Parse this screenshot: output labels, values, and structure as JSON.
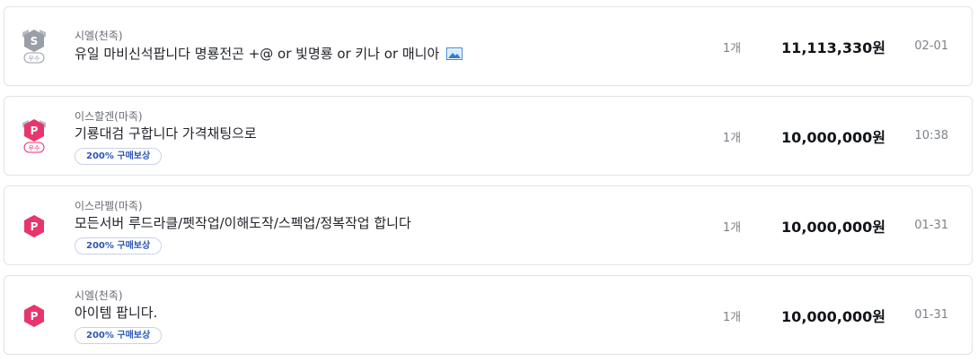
{
  "colors": {
    "power_seller_pink": "#e8356b",
    "silver_gray": "#9a9ea6",
    "reward_blue": "#2b56b8",
    "price_text": "#111418"
  },
  "listings": [
    {
      "badge_icon": "silver-seller-badge-icon",
      "badge_text": "우수",
      "server": "시엘(천족)",
      "title": "유일 마비신석팝니다 명룡전곤 +@ or 빛명룡 or 키나 or 매니아",
      "has_image": true,
      "reward": "",
      "qty": "1개",
      "price": "11,113,330원",
      "time": "02-01"
    },
    {
      "badge_icon": "power-seller-excellent-badge-icon",
      "badge_text": "우수",
      "server": "이스할겐(마족)",
      "title": "기룡대검 구합니다 가격채팅으로",
      "has_image": false,
      "reward": "200% 구매보상",
      "qty": "1개",
      "price": "10,000,000원",
      "time": "10:38"
    },
    {
      "badge_icon": "power-seller-badge-icon",
      "badge_text": "",
      "server": "이스라펠(마족)",
      "title": "모든서버 루드라클/펫작업/이해도작/스펙업/정복작업 합니다",
      "has_image": false,
      "reward": "200% 구매보상",
      "qty": "1개",
      "price": "10,000,000원",
      "time": "01-31"
    },
    {
      "badge_icon": "power-seller-badge-icon",
      "badge_text": "",
      "server": "시엘(천족)",
      "title": "아이템 팝니다.",
      "has_image": false,
      "reward": "200% 구매보상",
      "qty": "1개",
      "price": "10,000,000원",
      "time": "01-31"
    }
  ]
}
